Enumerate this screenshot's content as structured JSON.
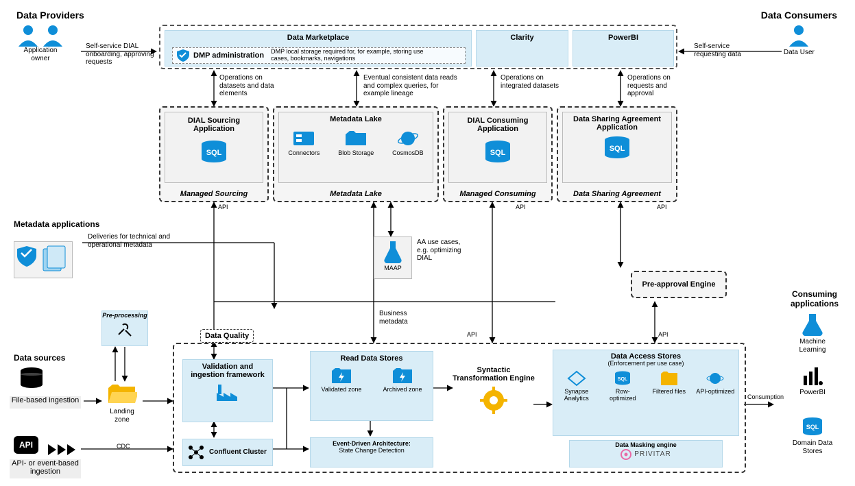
{
  "headers": {
    "providers": "Data Providers",
    "consumers": "Data Consumers",
    "appOwner": "Application owner",
    "dataUser": "Data User",
    "marketplace": "Data Marketplace",
    "clarity": "Clarity",
    "powerbi": "PowerBI",
    "dmpAdmin": "DMP administration",
    "dmpDesc": "DMP local storage required for, for example, storing use cases, bookmarks, navigations"
  },
  "labels": {
    "selfServiceDial": "Self-service DIAL onboarding, approving requests",
    "selfServiceReq": "Self-service requesting data",
    "opsDatasets": "Operations on datasets and data elements",
    "eventualReads": "Eventual consistent data reads and complex queries, for example lineage",
    "opsIntegrated": "Operations on integrated datasets",
    "opsRequests": "Operations on requests and approval",
    "api": "API",
    "cdc": "CDC",
    "consumption": "Consumption",
    "deliveries": "Deliveries for technical and operational metadata",
    "aaUse": "AA use cases, e.g. optimizing DIAL",
    "bizMeta": "Business metadata"
  },
  "apps": {
    "dialSourcing": {
      "title": "DIAL Sourcing Application",
      "sub": "Managed Sourcing"
    },
    "metadataLake": {
      "title": "Metadata Lake",
      "sub": "Metadata Lake",
      "c1": "Connectors",
      "c2": "Blob Storage",
      "c3": "CosmosDB"
    },
    "dialConsuming": {
      "title": "DIAL Consuming Application",
      "sub": "Managed Consuming"
    },
    "dataSharing": {
      "title": "Data Sharing Agreement Application",
      "sub": "Data Sharing Agreement"
    },
    "maap": "MAAP",
    "preApproval": "Pre-approval Engine"
  },
  "left": {
    "metadataApps": "Metadata applications",
    "dataSources": "Data sources",
    "fileBased": "File-based ingestion",
    "apiIcon": "API",
    "apiBased": "API- or event-based ingestion",
    "preprocessing": "Pre-processing",
    "landing": "Landing zone"
  },
  "pipeline": {
    "dataQuality": "Data Quality",
    "validation": "Validation and ingestion framework",
    "confluent": "Confluent Cluster",
    "readStores": "Read Data Stores",
    "validated": "Validated zone",
    "archived": "Archived zone",
    "eda": "Event-Driven Architecture:",
    "edaSub": "State Change Detection",
    "syntactic": "Syntactic Transformation Engine",
    "dataAccess": "Data Access Stores",
    "enforcement": "(Enforcement per use case)",
    "da1": "Synapse Analytics",
    "da2": "Row-optimized",
    "da3": "Filtered files",
    "da4": "API-optimized",
    "masking": "Data Masking engine",
    "privitar": "PRIVITAR"
  },
  "right": {
    "consumingApps": "Consuming applications",
    "ml": "Machine Learning",
    "powerbi": "PowerBI",
    "dds": "Domain Data Stores"
  }
}
